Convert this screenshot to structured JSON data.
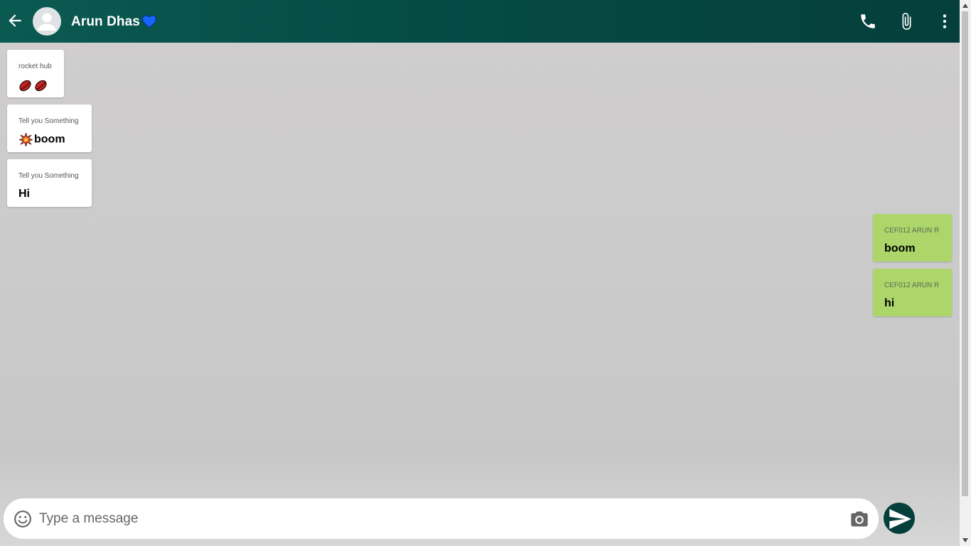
{
  "header": {
    "contact_name": "Arun Dhas",
    "icons": [
      "back-arrow-icon",
      "avatar-icon",
      "blue-heart-icon",
      "phone-icon",
      "paperclip-icon",
      "more-vert-icon"
    ]
  },
  "messages": [
    {
      "direction": "incoming",
      "sender": "rocket hub",
      "text": "",
      "emoji": "lips-lips"
    },
    {
      "direction": "incoming",
      "sender": "Tell you Something",
      "text": "boom",
      "emoji": "collision"
    },
    {
      "direction": "incoming",
      "sender": "Tell you Something",
      "text": "Hi"
    },
    {
      "direction": "outgoing",
      "sender": "CEF012 ARUN R",
      "text": "boom"
    },
    {
      "direction": "outgoing",
      "sender": "CEF012 ARUN R",
      "text": "hi"
    }
  ],
  "composer": {
    "placeholder": "Type a message",
    "value": ""
  },
  "colors": {
    "header": "#054c45",
    "incoming_bubble": "#ffffff",
    "outgoing_bubble": "#acd56a",
    "send_button": "#053f3b",
    "heart": "#1565ff"
  }
}
